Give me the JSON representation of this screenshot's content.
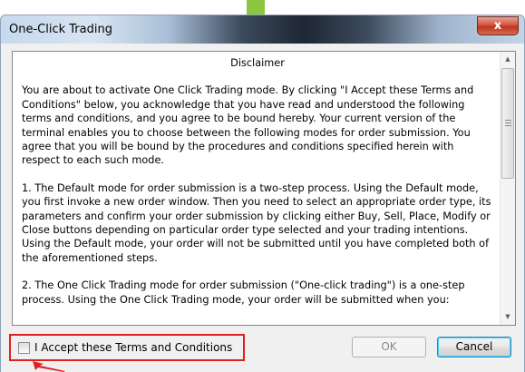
{
  "window": {
    "title": "One-Click Trading",
    "close_glyph": "x"
  },
  "disclaimer": {
    "heading": "Disclaimer",
    "paragraphs": [
      "You are about to activate One Click Trading mode. By clicking \"I Accept these Terms and Conditions\" below, you acknowledge that you have read and understood the following terms and conditions, and you agree to be bound hereby. Your current version of the terminal enables you to choose between the following modes for order submission. You agree that you will be bound by the procedures and conditions specified herein with respect to each such mode.",
      "1. The Default mode for order submission is a two-step process. Using the Default mode, you first invoke a new order window. Then you need to select an appropriate order type, its parameters and confirm your order submission by clicking either Buy, Sell, Place, Modify or Close buttons depending on particular order type selected and your trading intentions. Using the Default mode, your order will not be submitted until you have completed both of the aforementioned steps.",
      "2. The One Click Trading mode for order submission (\"One-click trading\") is a one-step process. Using the One Click Trading mode, your order will be submitted when you:"
    ]
  },
  "accept": {
    "label": "I Accept these Terms and Conditions",
    "checked": false
  },
  "buttons": {
    "ok_label": "OK",
    "cancel_label": "Cancel"
  },
  "colors": {
    "highlight": "#e02020",
    "accent_tab": "#8cc63f"
  },
  "icons": {
    "scroll_up": "scroll-up-arrow-icon",
    "scroll_down": "scroll-down-arrow-icon",
    "annotation": "red-arrow-icon"
  }
}
